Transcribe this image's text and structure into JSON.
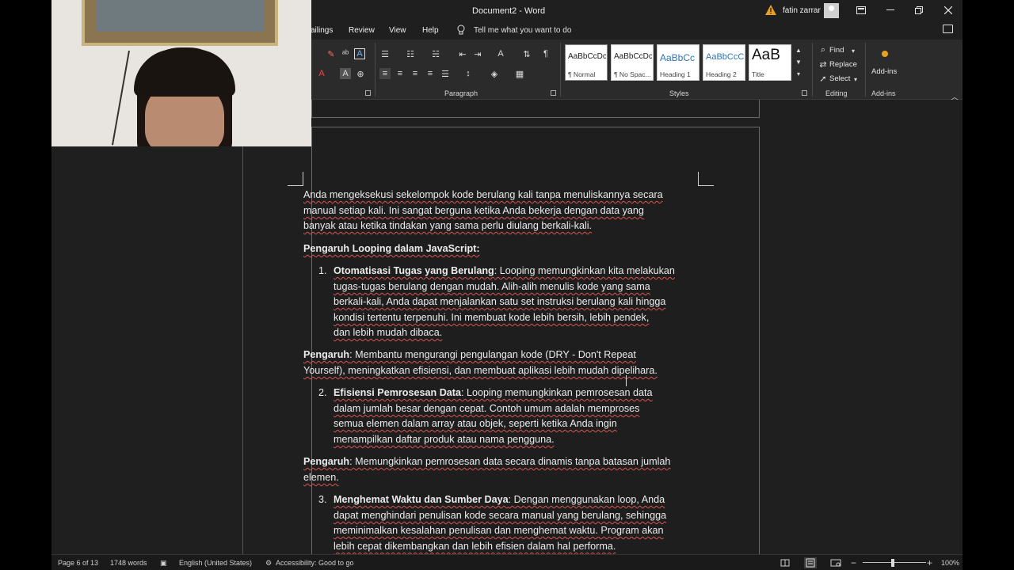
{
  "window": {
    "title": "Document2 - Word",
    "user": "fatin zarrar",
    "controls": [
      "restore-ribbon",
      "minimize",
      "maximize",
      "close"
    ]
  },
  "menu": {
    "tabs": [
      "ailings",
      "Review",
      "View",
      "Help"
    ],
    "tell_me": "Tell me what you want to do"
  },
  "ribbon": {
    "groups": {
      "paragraph": "Paragraph",
      "styles": "Styles",
      "editing": "Editing",
      "addins": "Add-ins"
    },
    "styles": [
      {
        "sample": "AaBbCcDc",
        "name": "¶ Normal"
      },
      {
        "sample": "AaBbCcDc",
        "name": "¶ No Spac..."
      },
      {
        "sample": "AaBbCc",
        "name": "Heading 1"
      },
      {
        "sample": "AaBbCcC",
        "name": "Heading 2"
      },
      {
        "sample": "AaB",
        "name": "Title"
      }
    ],
    "editing": {
      "find": "Find",
      "replace": "Replace",
      "select": "Select"
    },
    "addins_button": "Add-ins"
  },
  "document": {
    "p1": [
      "Anda mengeksekusi sekelompok kode berulang kali tanpa menuliskannya secara",
      "manual setiap kali. Ini sangat berguna ketika Anda bekerja dengan data yang",
      "banyak atau ketika tindakan yang sama perlu diulang berkali-kali."
    ],
    "heading": "Pengaruh Looping dalam JavaScript:",
    "item1": {
      "num": "1.",
      "title": "Otomatisasi Tugas yang Berulang",
      "lines": [
        ": Looping memungkinkan kita melakukan",
        "tugas-tugas berulang dengan mudah. Alih-alih menulis kode yang sama",
        "berkali-kali, Anda dapat menjalankan satu set instruksi berulang kali hingga",
        "kondisi tertentu terpenuhi. Ini membuat kode lebih bersih, lebih pendek,",
        "dan lebih mudah dibaca."
      ]
    },
    "effect1": {
      "label": "Pengaruh",
      "lines": [
        ": Membantu mengurangi pengulangan kode (DRY - Don't Repeat",
        "Yourself), meningkatkan efisiensi, dan membuat aplikasi lebih mudah dipelihara."
      ]
    },
    "item2": {
      "num": "2.",
      "title": "Efisiensi Pemrosesan Data",
      "lines": [
        ": Looping memungkinkan pemrosesan data",
        "dalam jumlah besar dengan cepat. Contoh umum adalah memproses",
        "semua elemen dalam array atau objek, seperti ketika Anda ingin",
        "menampilkan daftar produk atau nama pengguna."
      ]
    },
    "effect2": {
      "label": "Pengaruh",
      "lines": [
        ": Memungkinkan pemrosesan data secara dinamis tanpa batasan jumlah",
        "elemen."
      ]
    },
    "item3": {
      "num": "3.",
      "title": "Menghemat Waktu dan Sumber Daya",
      "lines": [
        ": Dengan menggunakan loop, Anda",
        "dapat menghindari penulisan kode secara manual yang berulang, sehingga",
        "meminimalkan kesalahan penulisan dan menghemat waktu. Program akan",
        "lebih cepat dikembangkan dan lebih efisien dalam hal performa."
      ]
    }
  },
  "status": {
    "page": "Page 6 of 13",
    "words": "1748 words",
    "language": "English (United States)",
    "accessibility": "Accessibility: Good to go",
    "zoom": "100%",
    "zoom_level": 1.0
  },
  "colors": {
    "background": "#1f1f1f",
    "ribbon": "#2b2b2b",
    "spelling_underline": "#d9534f",
    "addins_dot": "#e8a020"
  }
}
